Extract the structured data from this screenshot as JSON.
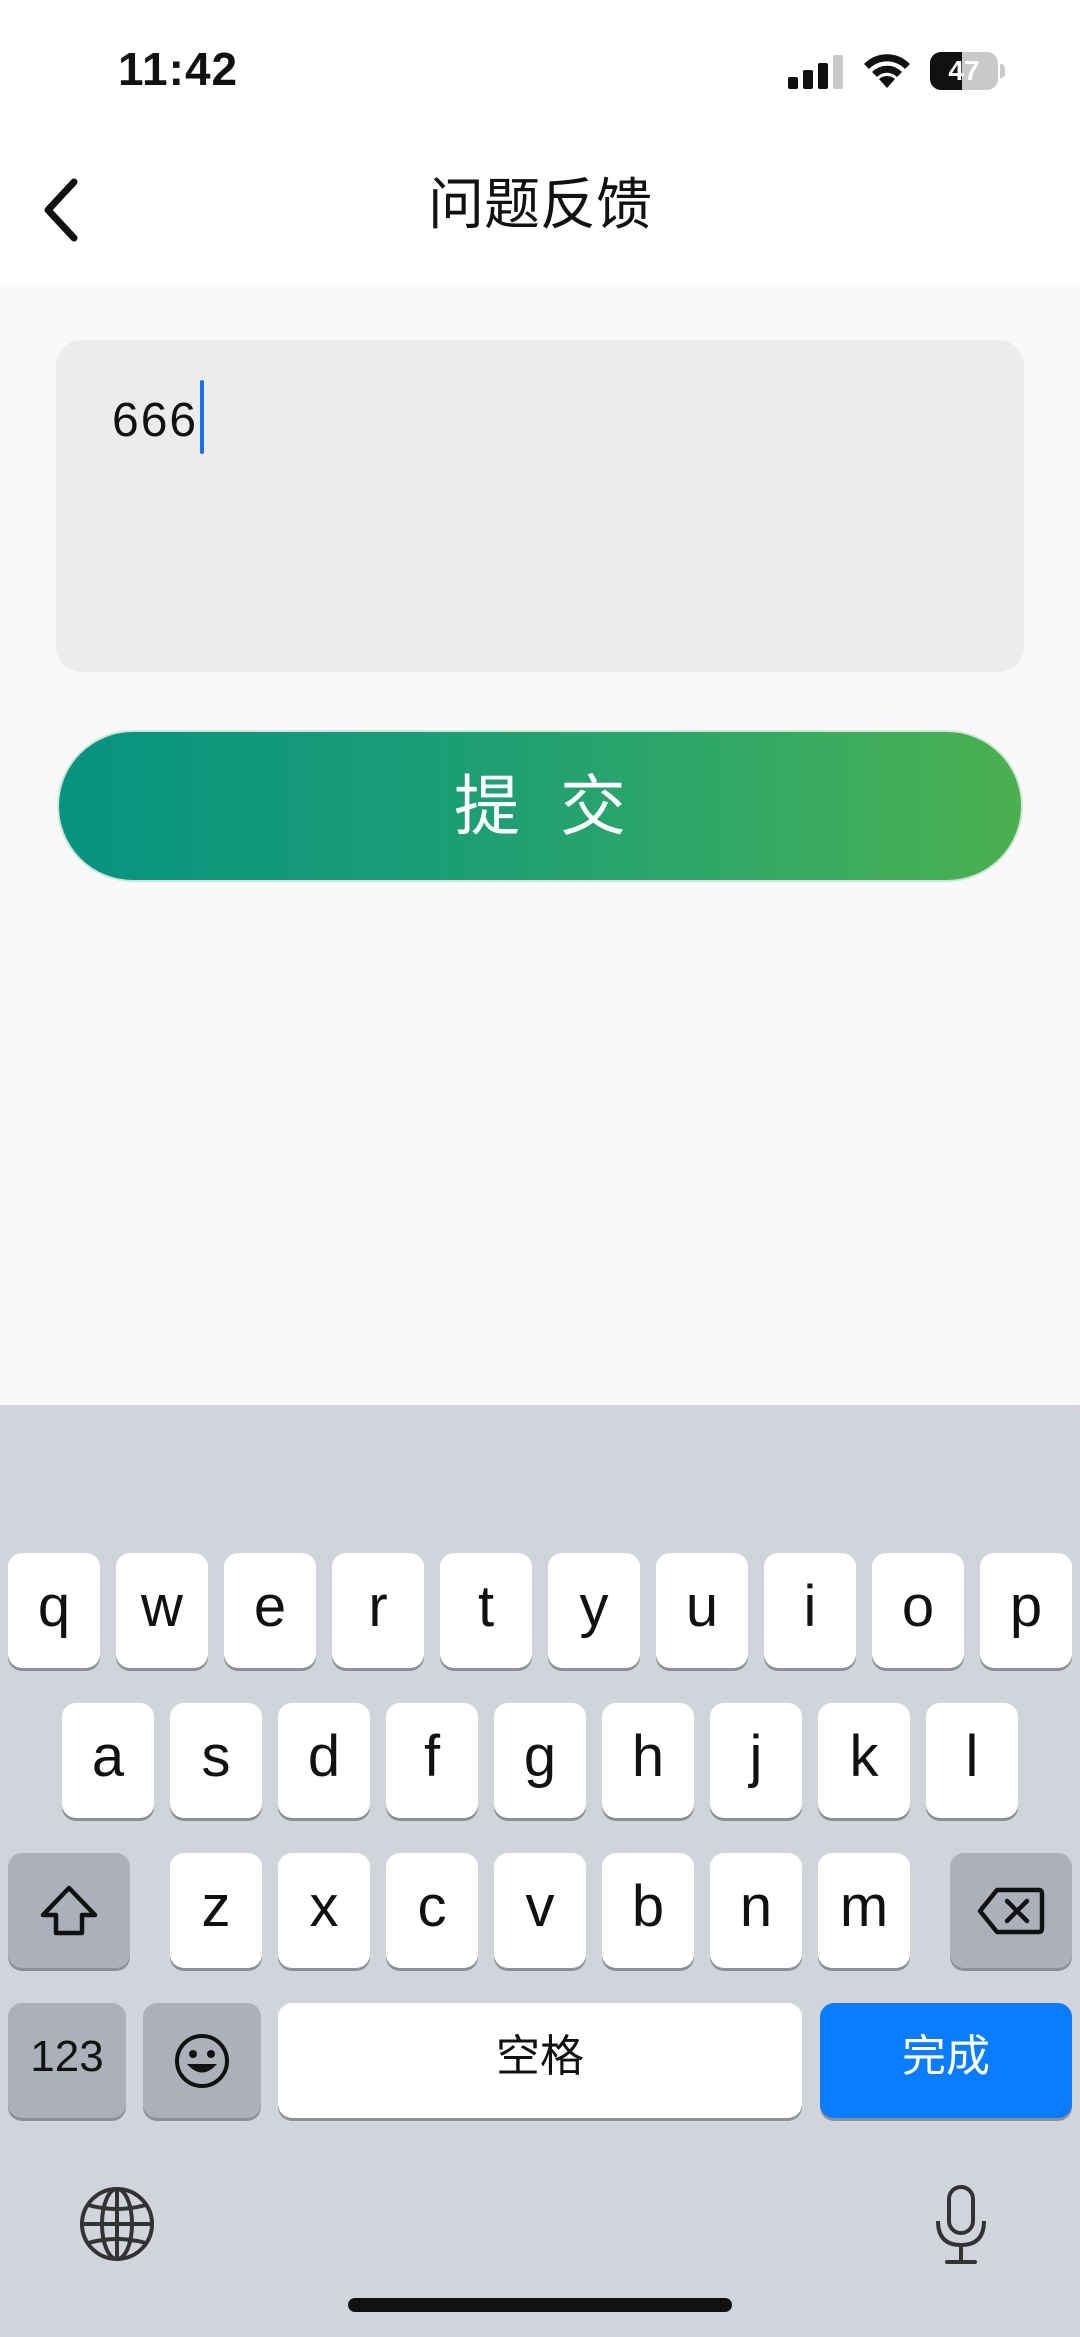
{
  "status_bar": {
    "time": "11:42",
    "battery_percent": "47",
    "battery_level": 0.47
  },
  "nav": {
    "title": "问题反馈"
  },
  "feedback": {
    "value": "666"
  },
  "submit": {
    "label": "提交",
    "gradient_start": "#079381",
    "gradient_end": "#4caf50"
  },
  "keyboard": {
    "row1": [
      "q",
      "w",
      "e",
      "r",
      "t",
      "y",
      "u",
      "i",
      "o",
      "p"
    ],
    "row2": [
      "a",
      "s",
      "d",
      "f",
      "g",
      "h",
      "j",
      "k",
      "l"
    ],
    "row3": [
      "z",
      "x",
      "c",
      "v",
      "b",
      "n",
      "m"
    ],
    "numbers_label": "123",
    "space_label": "空格",
    "done_label": "完成",
    "done_color": "#0a7cff"
  },
  "icons": {
    "back": "chevron-left-icon",
    "shift": "shift-icon",
    "delete": "delete-backspace-icon",
    "emoji": "emoji-icon",
    "globe": "globe-icon",
    "mic": "microphone-icon"
  }
}
